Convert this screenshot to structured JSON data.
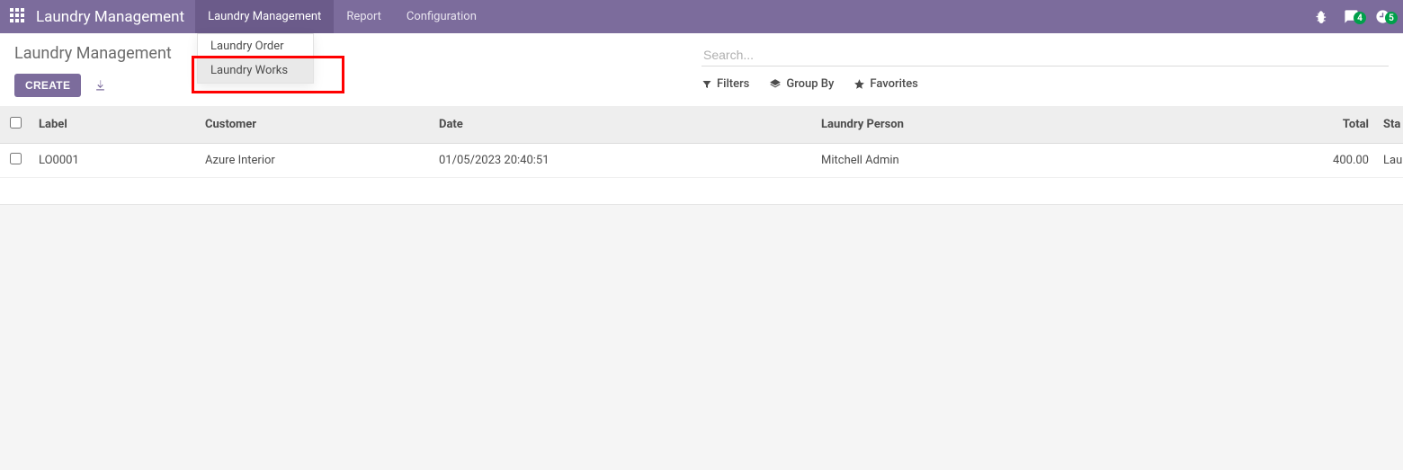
{
  "header": {
    "app_title": "Laundry Management",
    "nav": [
      "Laundry Management",
      "Report",
      "Configuration"
    ],
    "badges": {
      "chat": "4",
      "activity": "5"
    }
  },
  "dropdown": {
    "items": [
      "Laundry Order",
      "Laundry Works"
    ]
  },
  "control_panel": {
    "breadcrumb": "Laundry Management",
    "create_label": "CREATE",
    "search_placeholder": "Search...",
    "filters_label": "Filters",
    "groupby_label": "Group By",
    "favorites_label": "Favorites"
  },
  "table": {
    "headers": {
      "label": "Label",
      "customer": "Customer",
      "date": "Date",
      "person": "Laundry Person",
      "total": "Total",
      "status": "Sta"
    },
    "rows": [
      {
        "label": "LO0001",
        "customer": "Azure Interior",
        "date": "01/05/2023 20:40:51",
        "person": "Mitchell Admin",
        "total": "400.00",
        "status": "Lau"
      }
    ]
  }
}
